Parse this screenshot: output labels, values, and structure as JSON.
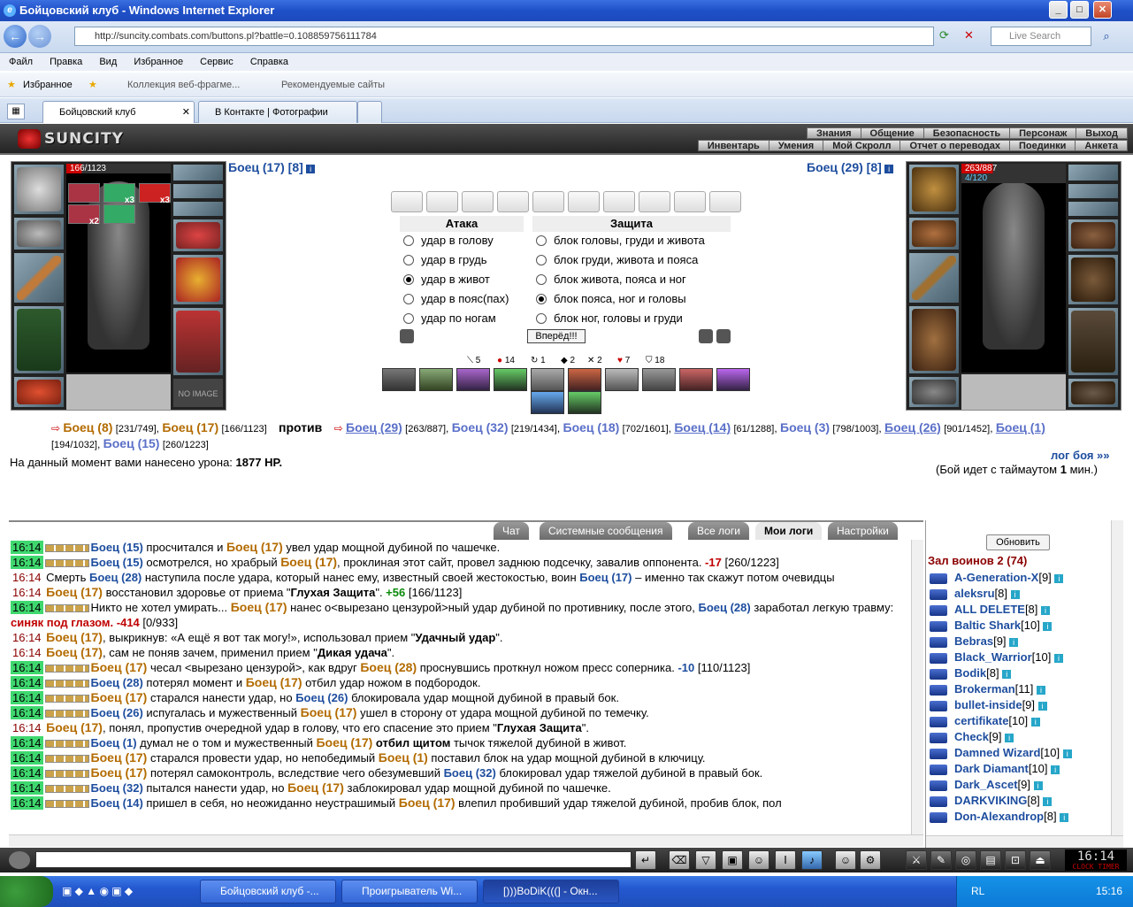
{
  "window": {
    "title": "Бойцовский клуб - Windows Internet Explorer"
  },
  "browser": {
    "url": "http://suncity.combats.com/buttons.pl?battle=0.108859756111784",
    "search_placeholder": "Live Search",
    "menu": [
      "Файл",
      "Правка",
      "Вид",
      "Избранное",
      "Сервис",
      "Справка"
    ],
    "favorites_label": "Избранное",
    "fav_links": [
      "Коллекция веб-фрагме...",
      "Рекомендуемые сайты"
    ],
    "tabs": [
      {
        "label": "Бойцовский клуб"
      },
      {
        "label": "В Контакте | Фотографии"
      }
    ]
  },
  "game": {
    "logo": "SUNCITY",
    "top_menu": [
      "Знания",
      "Общение",
      "Безопасность",
      "Персонаж",
      "Выход"
    ],
    "sub_menu": [
      "Инвентарь",
      "Умения",
      "Мой Скролл",
      "Отчет о переводах",
      "Поединки",
      "Анкета"
    ],
    "player": {
      "name": "Боец (17) [8]",
      "hp": "166/1123",
      "buffs": [
        "x3",
        "x3",
        "x2"
      ]
    },
    "opponent": {
      "name": "Боец (29) [8]",
      "hp": "263/887",
      "mana": "4/120"
    },
    "no_image": "NO IMAGE",
    "attack": {
      "header": "Атака",
      "options": [
        "удар в голову",
        "удар в грудь",
        "удар в живот",
        "удар в пояс(пах)",
        "удар по ногам"
      ],
      "selected": 2
    },
    "defense": {
      "header": "Защита",
      "options": [
        "блок головы, груди и живота",
        "блок груди, живота и пояса",
        "блок живота, пояса и ног",
        "блок пояса, ног и головы",
        "блок ног, головы и груди"
      ],
      "selected": 3
    },
    "go_button": "Вперёд!!!",
    "stats": [
      "5",
      "14",
      "1",
      "2",
      "2",
      "7",
      "18"
    ],
    "vs": {
      "team1": [
        {
          "n": "Боец (8)",
          "hp": "[231/749]"
        },
        {
          "n": "Боец (17)",
          "hp": "[166/1123]"
        }
      ],
      "against": "против",
      "team2": [
        {
          "n": "Боец (29)",
          "hp": "[263/887]"
        },
        {
          "n": "Боец (32)",
          "hp": "[219/1434]"
        },
        {
          "n": "Боец (18)",
          "hp": "[702/1601]"
        },
        {
          "n": "Боец (14)",
          "hp": "[61/1288]"
        },
        {
          "n": "Боец (3)",
          "hp": "[798/1003]"
        },
        {
          "n": "Боец (26)",
          "hp": "[901/1452]"
        },
        {
          "n": "Боец (1)",
          "hp": "[194/1032]"
        },
        {
          "n": "Боец (15)",
          "hp": "[260/1223]"
        }
      ]
    },
    "damage_text": "На данный момент вами нанесено урона:",
    "damage_value": "1877 HP.",
    "battle_log_link": "лог боя »»",
    "timeout_text": "(Бой идет с таймаутом",
    "timeout_value": "1",
    "timeout_unit": "мин.)",
    "log_tabs": [
      "Чат",
      "Системные сообщения",
      "Все логи",
      "Мои логи",
      "Настройки"
    ],
    "log": [
      {
        "t": "16:14",
        "g": true,
        "html": "<span class='blu'>Боец (15)</span> просчитался и <span class='o'>Боец (17)</span> увел удар мощной дубиной по чашечке."
      },
      {
        "t": "16:14",
        "g": true,
        "html": "<span class='blu'>Боец (15)</span> осмотрелся, но храбрый <span class='o'>Боец (17)</span>, проклиная этот сайт, провел заднюю подсечку, завалив оппонента. <span class='red'>-17</span> [260/1223]"
      },
      {
        "t": "16:14",
        "g": false,
        "html": "Смерть <span class='blu'>Боец (28)</span> наступила после удара, который нанес ему, известный своей жестокостью, воин <span class='blu'>Боец (17)</span> – именно так скажут потом очевидцы"
      },
      {
        "t": "16:14",
        "g": false,
        "html": "<span class='o'>Боец (17)</span> восстановил здоровье от приема \"<span class='bold'>Глухая Защита</span>\". <span style='color:#0a8a0a;font-weight:bold'>+56</span> [166/1123]"
      },
      {
        "t": "16:14",
        "g": true,
        "html": "Никто не хотел умирать... <span class='o'>Боец (17)</span> нанес о&lt;вырезано цензурой&gt;ный удар дубиной по противнику, после этого, <span class='blu'>Боец (28)</span> заработал легкую травму: <span class='red'>синяк под глазом.</span> <span class='red'>-414</span> [0/933]"
      },
      {
        "t": "16:14",
        "g": false,
        "html": "<span class='o'>Боец (17)</span>, выкрикнув: «А ещё я вот так могу!», использовал прием \"<span class='bold'>Удачный удар</span>\"."
      },
      {
        "t": "16:14",
        "g": false,
        "html": "<span class='o'>Боец (17)</span>, сам не поняв зачем, применил прием \"<span class='bold'>Дикая удача</span>\"."
      },
      {
        "t": "16:14",
        "g": true,
        "html": "<span class='o'>Боец (17)</span> чесал &lt;вырезано цензурой&gt;, как вдруг <span class='o'>Боец (28)</span> проснувшись проткнул ножом пресс соперника. <span class='blu'>-10</span> [110/1123]"
      },
      {
        "t": "16:14",
        "g": true,
        "html": "<span class='blu'>Боец (28)</span> потерял момент и <span class='o'>Боец (17)</span> отбил удар ножом в подбородок."
      },
      {
        "t": "16:14",
        "g": true,
        "html": "<span class='o'>Боец (17)</span> старался нанести удар, но <span class='blu'>Боец (26)</span> блокировала удар мощной дубиной в правый бок."
      },
      {
        "t": "16:14",
        "g": true,
        "html": "<span class='blu'>Боец (26)</span> испугалась и мужественный <span class='o'>Боец (17)</span> ушел в сторону от удара мощной дубиной по темечку."
      },
      {
        "t": "16:14",
        "g": false,
        "html": "<span class='o'>Боец (17)</span>, понял, пропустив очередной удар в голову, что его спасение это прием \"<span class='bold'>Глухая Защита</span>\"."
      },
      {
        "t": "16:14",
        "g": true,
        "html": "<span class='blu'>Боец (1)</span> думал не о том и мужественный <span class='o'>Боец (17)</span> <span class='bold'>отбил щитом</span> тычок тяжелой дубиной в живот."
      },
      {
        "t": "16:14",
        "g": true,
        "html": "<span class='o'>Боец (17)</span> старался провести удар, но непобедимый <span class='o'>Боец (1)</span> поставил блок на удар мощной дубиной в ключицу."
      },
      {
        "t": "16:14",
        "g": true,
        "html": "<span class='o'>Боец (17)</span> потерял самоконтроль, вследствие чего обезумевший <span class='blu'>Боец (32)</span> блокировал удар тяжелой дубиной в правый бок."
      },
      {
        "t": "16:14",
        "g": true,
        "html": "<span class='blu'>Боец (32)</span> пытался нанести удар, но <span class='o'>Боец (17)</span> заблокировал удар мощной дубиной по чашечке."
      },
      {
        "t": "16:14",
        "g": true,
        "html": "<span class='blu'>Боец (14)</span> пришел в себя, но неожиданно неустрашимый <span class='o'>Боец (17)</span> влепил пробивший удар тяжелой дубиной, пробив блок, пол"
      }
    ],
    "refresh_button": "Обновить",
    "room": "Зал воинов 2 (74)",
    "users": [
      {
        "n": "A-Generation-X",
        "l": "[9]"
      },
      {
        "n": "aleksru",
        "l": "[8]"
      },
      {
        "n": "ALL DELETE",
        "l": "[8]"
      },
      {
        "n": "Baltic Shark",
        "l": "[10]"
      },
      {
        "n": "Bebras",
        "l": "[9]"
      },
      {
        "n": "Black_Warrior",
        "l": "[10]"
      },
      {
        "n": "Bodik",
        "l": "[8]"
      },
      {
        "n": "Brokerman",
        "l": "[11]"
      },
      {
        "n": "bullet-inside",
        "l": "[9]"
      },
      {
        "n": "certifikate",
        "l": "[10]"
      },
      {
        "n": "Check",
        "l": "[9]"
      },
      {
        "n": "Damned Wizard",
        "l": "[10]"
      },
      {
        "n": "Dark Diamant",
        "l": "[10]"
      },
      {
        "n": "Dark_Ascet",
        "l": "[9]"
      },
      {
        "n": "DARKVIKING",
        "l": "[8]"
      },
      {
        "n": "Don-Alexandrop",
        "l": "[8]"
      }
    ],
    "clock": "16:14",
    "clock_sub": "CLOCK  TIMER"
  },
  "taskbar": {
    "items": [
      "Бойцовский клуб -...",
      "Проигрыватель Wi...",
      "[)))BoDiK(((] - Окн..."
    ],
    "lang": "RL",
    "time": "15:16"
  }
}
